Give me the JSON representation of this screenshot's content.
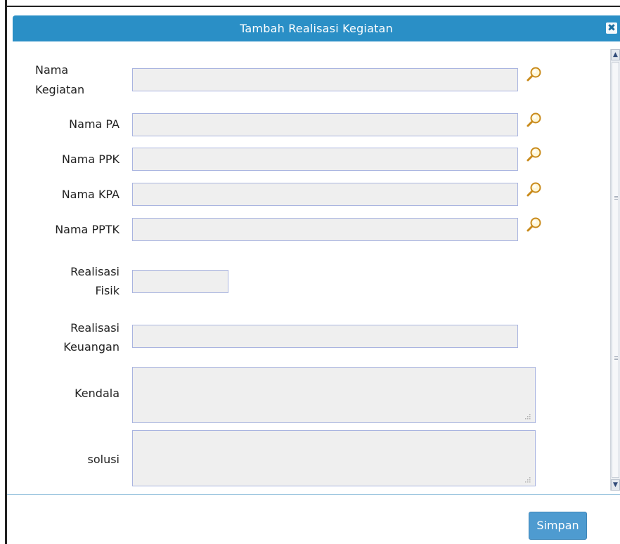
{
  "dialog": {
    "title": "Tambah Realisasi Kegiatan",
    "close_icon": "close-icon",
    "save_label": "Simpan"
  },
  "form": {
    "nama_kegiatan_label": "Nama\nKegiatan",
    "nama_pa_label": "Nama PA",
    "nama_ppk_label": "Nama PPK",
    "nama_kpa_label": "Nama KPA",
    "nama_pptk_label": "Nama PPTK",
    "realisasi_fisik_label": "Realisasi\nFisik",
    "realisasi_keuangan_label": "Realisasi\nKeuangan",
    "kendala_label": "Kendala",
    "solusi_label": "solusi",
    "nama_kegiatan_value": "",
    "nama_pa_value": "",
    "nama_ppk_value": "",
    "nama_kpa_value": "",
    "nama_pptk_value": "",
    "realisasi_fisik_value": "",
    "realisasi_keuangan_value": "",
    "kendala_value": "",
    "solusi_value": ""
  },
  "icons": {
    "lookup": "search-icon",
    "scroll_up": "arrow-up-icon",
    "scroll_down": "arrow-down-icon"
  },
  "colors": {
    "header_bg": "#2a8fc6",
    "button_bg": "#4e9bd0",
    "field_bg": "#efefef",
    "field_border": "#a9b4e0"
  }
}
